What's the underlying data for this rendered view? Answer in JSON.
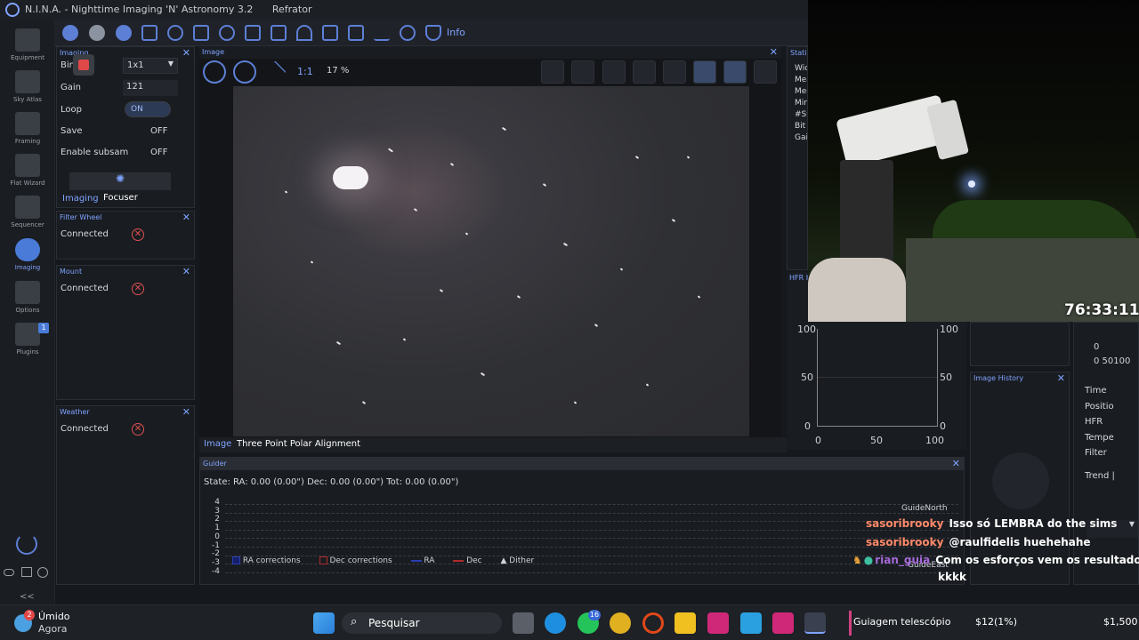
{
  "window": {
    "title": "N.I.N.A. - Nighttime Imaging 'N' Astronomy 3.2",
    "profile": "Refrator"
  },
  "sidebar": {
    "items": [
      {
        "label": "Equipment"
      },
      {
        "label": "Sky Atlas"
      },
      {
        "label": "Framing"
      },
      {
        "label": "Flat Wizard"
      },
      {
        "label": "Sequencer"
      },
      {
        "label": "Imaging"
      },
      {
        "label": "Options"
      },
      {
        "label": "Plugins",
        "badge": "1"
      }
    ],
    "collapse": "<<"
  },
  "toolbar": {
    "info_label": "Info"
  },
  "imaging_panel": {
    "header": "Imaging",
    "bin_label": "Bin",
    "bin_value": "1x1",
    "gain_label": "Gain",
    "gain_value": "121",
    "loop_label": "Loop",
    "loop_value": "ON",
    "save_label": "Save",
    "save_value": "OFF",
    "subsam_label": "Enable subsam",
    "subsam_value": "OFF",
    "tabs": [
      "Imaging",
      "Focuser"
    ]
  },
  "filter_wheel": {
    "header": "Filter Wheel",
    "label": "Connected"
  },
  "mount": {
    "header": "Mount",
    "label": "Connected"
  },
  "weather": {
    "header": "Weather",
    "label": "Connected"
  },
  "image": {
    "header": "Image",
    "one_to_one": "1:1",
    "zoom": "17 %",
    "tabs": [
      "Image",
      "Three Point Polar Alignment"
    ]
  },
  "statistics": {
    "header": "Statist",
    "rows": [
      "Wid",
      "Mea",
      "Med",
      "Min",
      "#Sta",
      "Bit d",
      "Gai"
    ]
  },
  "hfr": {
    "header": "HFR H",
    "y_ticks": [
      "100",
      "50",
      "0"
    ],
    "x_ticks": [
      "0",
      "50",
      "100"
    ]
  },
  "image_history": {
    "header": "Image History",
    "rows": [
      "Time",
      "Positio",
      "HFR",
      "Tempe",
      "Filter",
      "Trend"
    ],
    "zero": "0",
    "x_labels": "0 50100"
  },
  "guider": {
    "header": "Guider",
    "state": "State:  RA: 0.00 (0.00\")  Dec: 0.00 (0.00\")  Tot: 0.00 (0.00\")",
    "y_ticks": [
      "4",
      "3",
      "2",
      "1",
      "0",
      "-1",
      "-2",
      "-3",
      "-4"
    ],
    "north": "GuideNorth",
    "east": "GuideEast",
    "legend": [
      "RA corrections",
      "Dec corrections",
      "RA",
      "Dec",
      "Dither"
    ]
  },
  "overlay": {
    "timer": "76:33:11",
    "chat": [
      {
        "user": "sasoribrooky",
        "msg": "Isso só LEMBRA do the sims"
      },
      {
        "user": "sasoribrooky",
        "msg": "@raulfidelis huehehahe"
      },
      {
        "user": "rian_guia",
        "msg": "Com os esforços vem os resultados"
      },
      {
        "user": "",
        "msg": "kkkk"
      }
    ]
  },
  "taskbar": {
    "weather_badge": "2",
    "weather_title": "Úmido",
    "weather_sub": "Agora",
    "search": "Pesquisar",
    "whatsapp_badge": "16",
    "stream_label": "Guiagem telescópio",
    "stream_value": "$12(1%)",
    "stream_total": "$1,500"
  },
  "colors": {
    "accent": "#5d7fd6",
    "error": "#e05252",
    "chat_user": "#ff8a6a"
  }
}
